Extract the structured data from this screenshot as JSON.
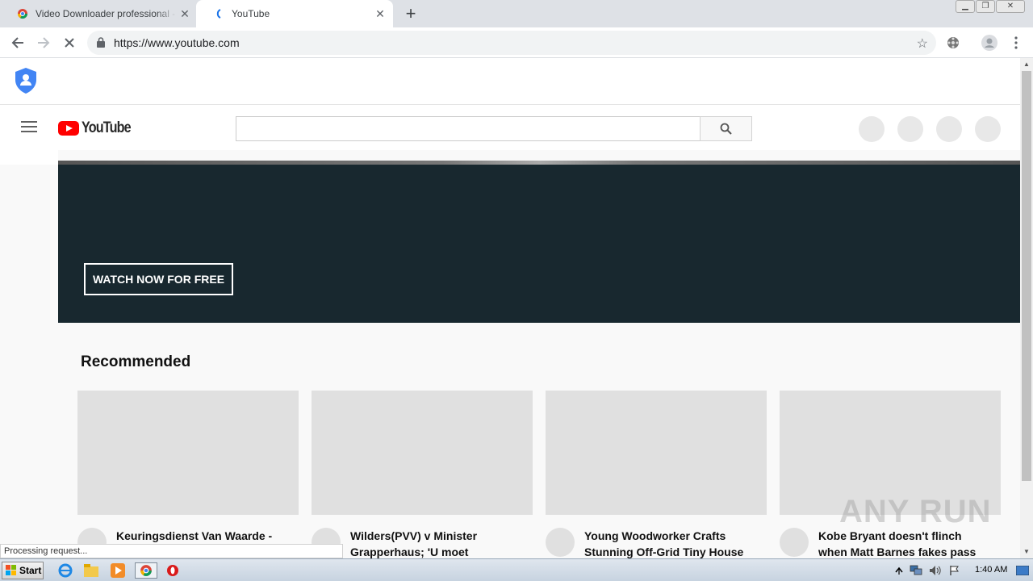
{
  "browser": {
    "tabs": [
      {
        "title": "Video Downloader professional - Chr",
        "active": false
      },
      {
        "title": "YouTube",
        "active": true
      }
    ],
    "url": "https://www.youtube.com",
    "status_text": "Processing request..."
  },
  "youtube": {
    "logo_text": "YouTube",
    "banner_button": "WATCH NOW FOR FREE",
    "section_title": "Recommended",
    "videos": [
      {
        "title": "Keuringsdienst Van Waarde -"
      },
      {
        "title": "Wilders(PVV) v Minister Grapperhaus; 'U moet gewoon…"
      },
      {
        "title": "Young Woodworker Crafts Stunning Off-Grid Tiny House"
      },
      {
        "title": "Kobe Bryant doesn't flinch when Matt Barnes fakes pass at his…"
      }
    ]
  },
  "taskbar": {
    "start_label": "Start",
    "clock": "1:40 AM"
  },
  "watermark": "ANY RUN",
  "colors": {
    "banner": "#18282f",
    "youtube_red": "#ff0000",
    "shield_blue": "#4285f4"
  }
}
